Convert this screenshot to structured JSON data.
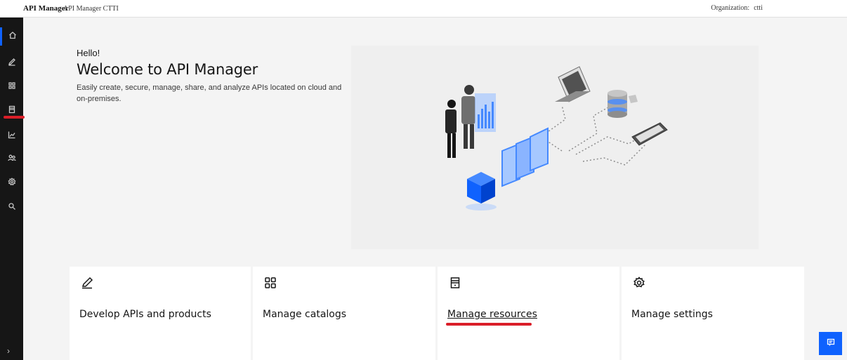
{
  "topbar": {
    "brand": "API Manager",
    "org_name": "API Manager CTTI",
    "organization_label": "Organization:",
    "organization_value": "ctti"
  },
  "rail": {
    "items": [
      {
        "icon": "home-icon"
      },
      {
        "icon": "pencil-icon"
      },
      {
        "icon": "grid-icon"
      },
      {
        "icon": "resource-icon"
      },
      {
        "icon": "chart-icon"
      },
      {
        "icon": "users-icon"
      },
      {
        "icon": "gear-icon"
      },
      {
        "icon": "search-icon"
      }
    ],
    "active_index": 0,
    "expand_icon": "›"
  },
  "hero": {
    "greeting": "Hello!",
    "title": "Welcome to API Manager",
    "description": "Easily create, secure, manage, share, and analyze APIs located on cloud and on-premises."
  },
  "tiles": [
    {
      "label": "Develop APIs and products",
      "icon": "pencil-icon"
    },
    {
      "label": "Manage catalogs",
      "icon": "grid-icon"
    },
    {
      "label": "Manage resources",
      "icon": "resource-icon"
    },
    {
      "label": "Manage settings",
      "icon": "gear-icon"
    }
  ],
  "colors": {
    "accent": "#0f62fe",
    "highlight": "#da1e28",
    "rail_bg": "#161616",
    "page_bg": "#f4f4f4"
  }
}
